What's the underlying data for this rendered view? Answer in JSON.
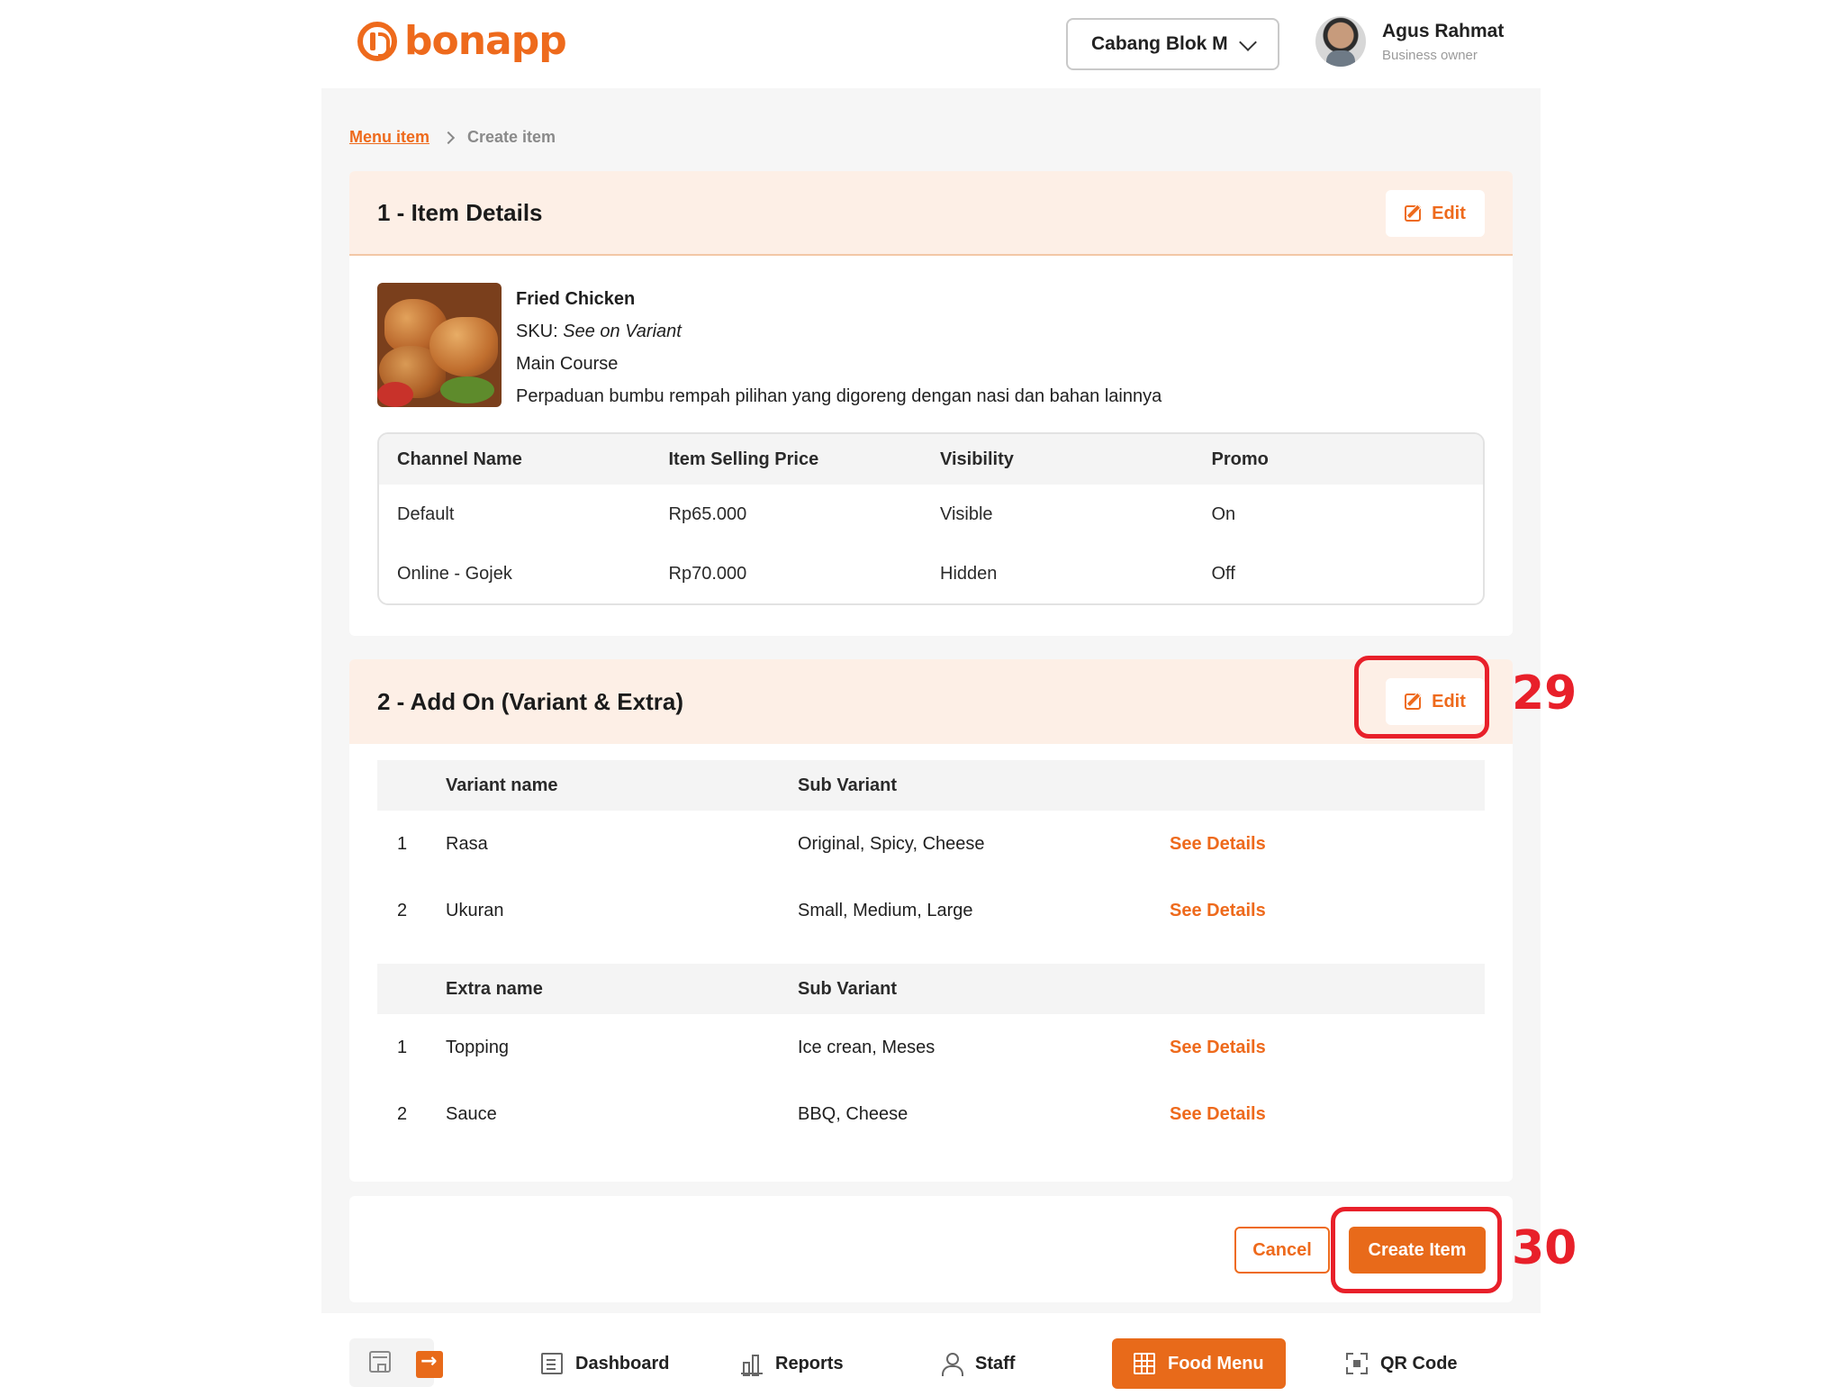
{
  "header": {
    "logo_text": "bonapp",
    "branch": "Cabang Blok M",
    "user_name": "Agus Rahmat",
    "user_role": "Business owner"
  },
  "breadcrumb": {
    "parent": "Menu item",
    "current": "Create item"
  },
  "item_details": {
    "title": "1 - Item Details",
    "edit_label": "Edit",
    "name": "Fried Chicken",
    "sku_label": "SKU:",
    "sku_value": "See on Variant",
    "category": "Main Course",
    "description": "Perpaduan bumbu rempah pilihan yang digoreng dengan nasi dan bahan lainnya",
    "channel_table": {
      "headers": [
        "Channel Name",
        "Item Selling Price",
        "Visibility",
        "Promo"
      ],
      "rows": [
        [
          "Default",
          "Rp65.000",
          "Visible",
          "On"
        ],
        [
          "Online - Gojek",
          "Rp70.000",
          "Hidden",
          "Off"
        ]
      ]
    }
  },
  "add_on": {
    "title": "2 - Add On (Variant & Extra)",
    "edit_label": "Edit",
    "variant_headers": [
      "Variant name",
      "Sub Variant"
    ],
    "variants": [
      {
        "no": "1",
        "name": "Rasa",
        "sub": "Original, Spicy, Cheese",
        "link": "See Details"
      },
      {
        "no": "2",
        "name": "Ukuran",
        "sub": "Small, Medium, Large",
        "link": "See Details"
      }
    ],
    "extra_headers": [
      "Extra name",
      "Sub Variant"
    ],
    "extras": [
      {
        "no": "1",
        "name": "Topping",
        "sub": "Ice crean, Meses",
        "link": "See Details"
      },
      {
        "no": "2",
        "name": "Sauce",
        "sub": "BBQ, Cheese",
        "link": "See Details"
      }
    ]
  },
  "actions": {
    "cancel_label": "Cancel",
    "create_label": "Create Item"
  },
  "annotations": {
    "step_29": "29",
    "step_30": "30",
    "color": "#e8202a"
  },
  "bottom_nav": {
    "items": [
      {
        "label": "Dashboard",
        "icon": "dashboard-icon"
      },
      {
        "label": "Reports",
        "icon": "reports-icon"
      },
      {
        "label": "Staff",
        "icon": "staff-icon"
      },
      {
        "label": "Food Menu",
        "icon": "food-menu-icon",
        "active": true
      },
      {
        "label": "QR Code",
        "icon": "qr-code-icon"
      }
    ]
  },
  "colors": {
    "brand": "#ee6a1c",
    "header_tint": "#fdefe6",
    "annotation": "#e8202a"
  }
}
